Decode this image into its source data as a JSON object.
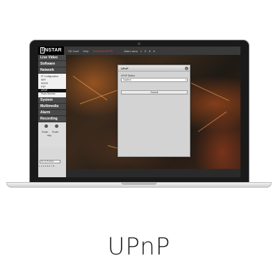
{
  "brand": {
    "logo_i": "I",
    "logo_rest": "NSTAR"
  },
  "topbar": {
    "links": [
      "SD Card",
      "Help"
    ],
    "resolution": "640x360/15FPS",
    "alarm_label": "Alarm area",
    "alarm_numbers": [
      "1",
      "2",
      "3",
      "4"
    ]
  },
  "sidebar": {
    "live_video": "Live Video",
    "software": "Software",
    "network": "Network",
    "network_items": [
      "IP Configuration",
      "WiFi",
      "DDNS",
      "P2P",
      "UPnP",
      "Push Service"
    ],
    "selected_item": "UPnP",
    "system": "System",
    "multimedia": "Multimedia",
    "alarm": "Alarm",
    "recording": "Recording",
    "ptz_labels": [
      "Hvuan",
      "Hvuan",
      "stop"
    ],
    "goto_position": "Go to Position",
    "position_numbers": "1 2 3 4 5 6 7 8"
  },
  "dialog": {
    "title": "UPnP",
    "field_label": "UPnP Status",
    "select_value": "inactive",
    "submit_label": "Submit",
    "close_glyph": "×"
  },
  "caption": "UPnP",
  "colors": {
    "accent_red": "#e23b3b",
    "sidebar_head": "#4a4a4a",
    "selected_bg": "#111111"
  }
}
